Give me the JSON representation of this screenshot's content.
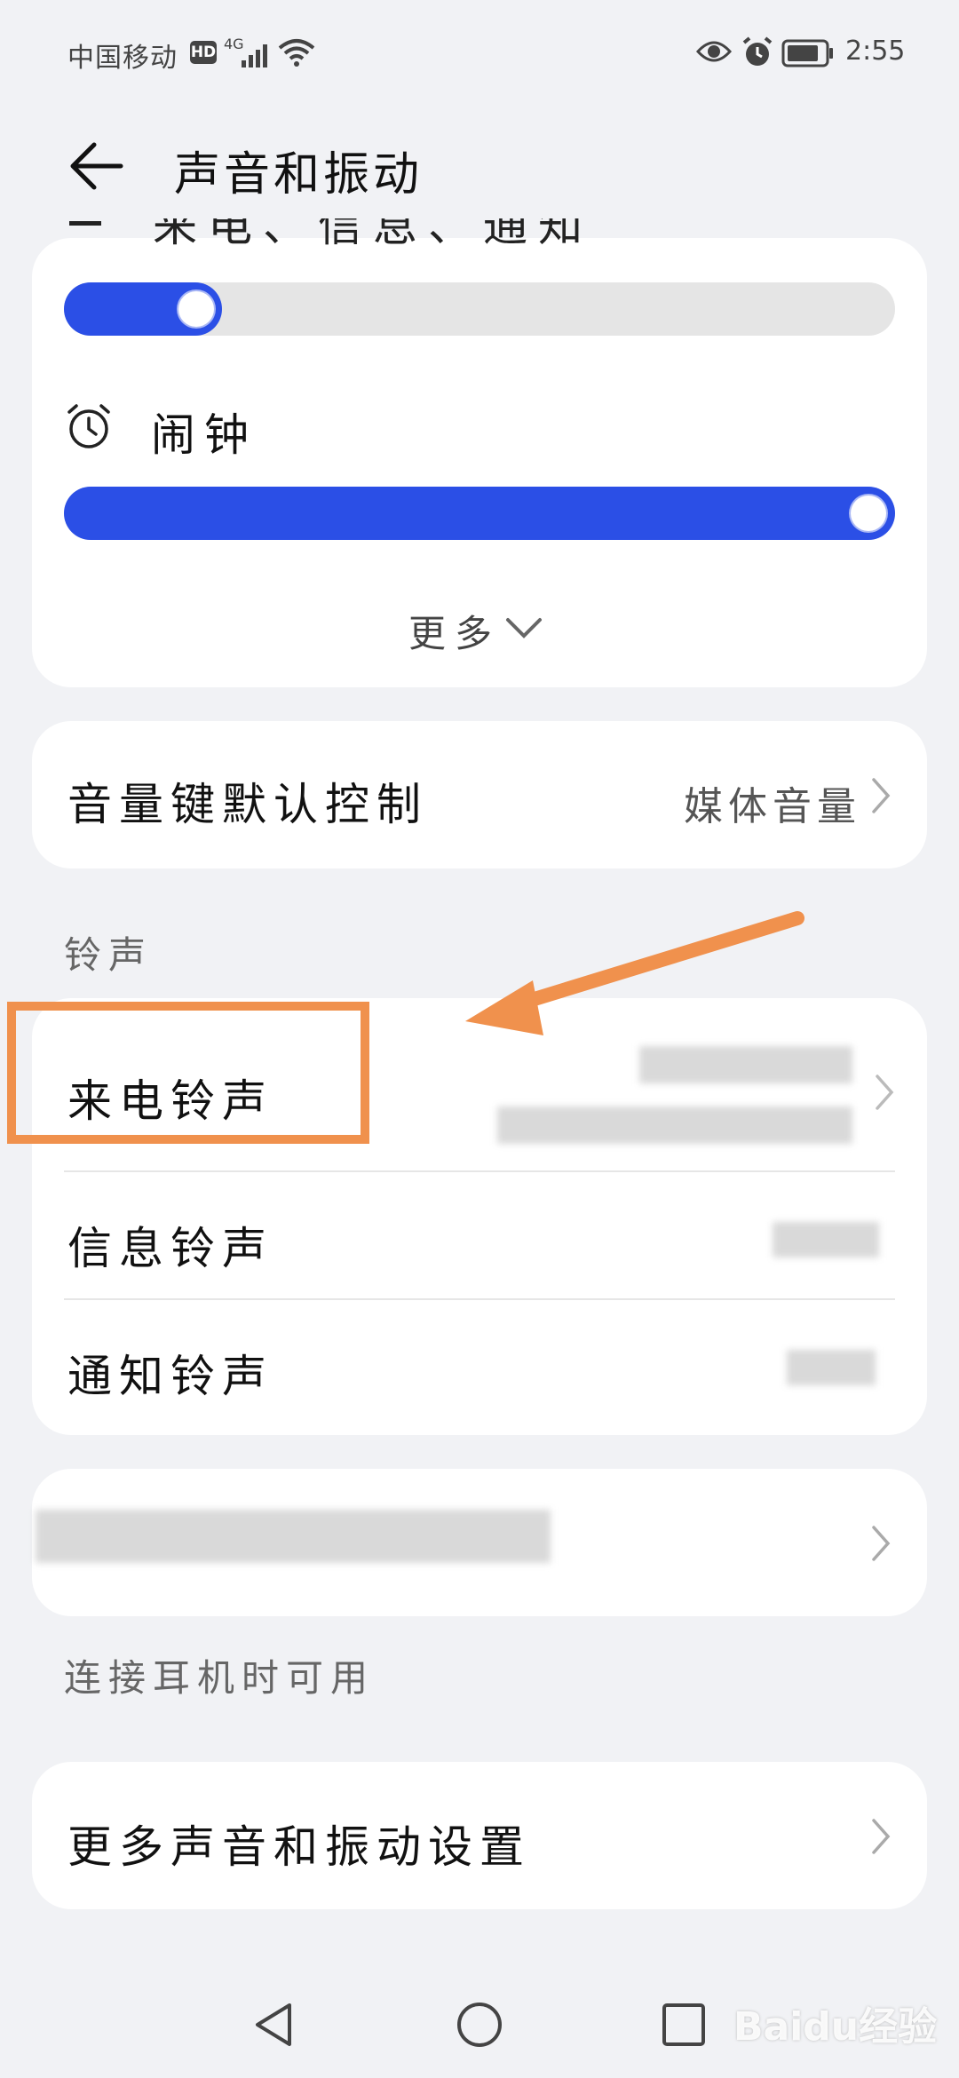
{
  "status_bar": {
    "carrier": "中国移动",
    "hd": "HD",
    "network": "4G",
    "time": "2:55"
  },
  "header": {
    "title": "声音和振动"
  },
  "volume": {
    "cut_label": "来电、信息、通知",
    "ringtone_level": 0.19,
    "alarm_label": "闹钟",
    "alarm_level": 1.0,
    "more_label": "更多"
  },
  "volume_key": {
    "label": "音量键默认控制",
    "value": "媒体音量"
  },
  "ringtones": {
    "section_title": "铃声",
    "rows": [
      {
        "label": "来电铃声"
      },
      {
        "label": "信息铃声"
      },
      {
        "label": "通知铃声"
      }
    ]
  },
  "headset": {
    "section_title": "连接耳机时可用"
  },
  "more_settings": {
    "label": "更多声音和振动设置"
  },
  "colors": {
    "accent": "#2b4fe6",
    "annotation": "#f0914d"
  },
  "watermark": "Baidu经验"
}
